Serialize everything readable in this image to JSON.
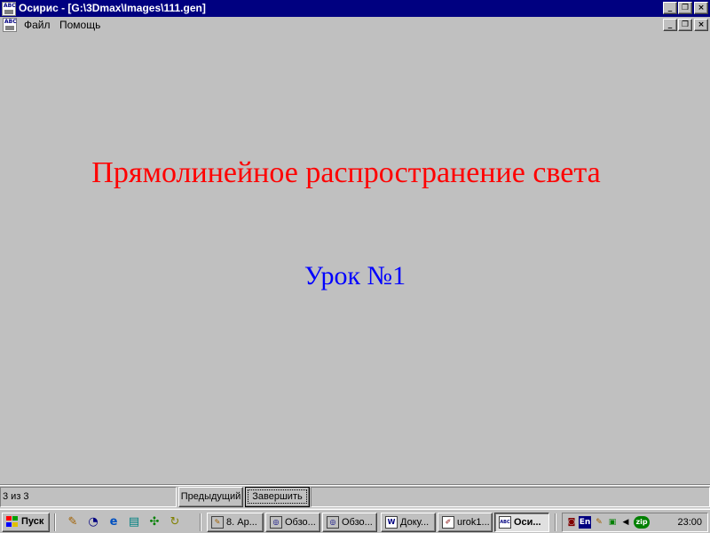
{
  "window": {
    "title": "Осирис - [G:\\3Dmax\\Images\\111.gen]",
    "app_icon": "abc-icon",
    "controls": {
      "minimize": "_",
      "restore": "❐",
      "close": "×"
    }
  },
  "menubar": {
    "items": [
      {
        "label": "Файл"
      },
      {
        "label": "Помощь"
      }
    ]
  },
  "slide": {
    "title": "Прямолинейное распространение света",
    "title_color": "#ff0000",
    "subtitle": "Урок №1",
    "subtitle_color": "#0000ff"
  },
  "statusbar": {
    "page_counter": "3 из 3",
    "prev_label": "Предыдущий",
    "finish_label": "Завершить"
  },
  "taskbar": {
    "start_label": "Пуск",
    "quicklaunch": [
      "pencil-icon",
      "satellite-dish-icon",
      "internet-explorer-icon",
      "notepad-icon",
      "network-icon",
      "refresh-icon"
    ],
    "tasks": [
      {
        "label": "8. Ар...",
        "icon": "pencil-icon",
        "active": false
      },
      {
        "label": "Обзо...",
        "icon": "magnifier-icon",
        "active": false
      },
      {
        "label": "Обзо...",
        "icon": "magnifier-icon",
        "active": false
      },
      {
        "label": "Доку...",
        "icon": "word-icon",
        "active": false
      },
      {
        "label": "urok1...",
        "icon": "paint-icon",
        "active": false
      },
      {
        "label": "Оси...",
        "icon": "abc-icon",
        "active": true
      }
    ],
    "tray": {
      "language": "En",
      "clock": "23:00",
      "zip_label": "zip"
    }
  }
}
